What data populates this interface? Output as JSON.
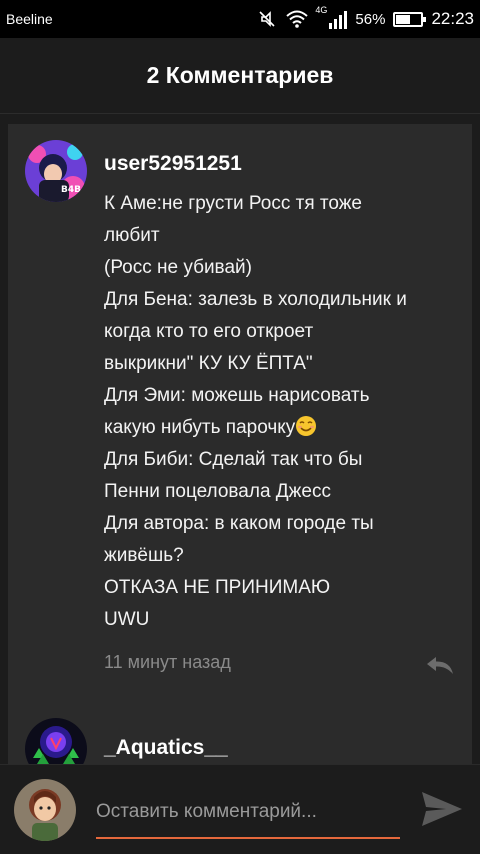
{
  "status_bar": {
    "carrier": "Beeline",
    "network": "4G",
    "battery": "56%",
    "battery_level": 0.56,
    "time": "22:23"
  },
  "header": {
    "title": "2 Комментариев"
  },
  "comments": [
    {
      "username": "user52951251",
      "avatar_text": "B4B",
      "lines": [
        "К Аме:не грусти Росс тя тоже",
        "любит",
        "(Росс не убивай)",
        "Для Бена: залезь в холодильник и",
        "когда кто то его откроет",
        "выкрикни\" КУ КУ ЁПТА\"",
        "Для Эми: можешь нарисовать",
        "какую нибуть парочку",
        "Для Биби: Сделай так что бы",
        "Пенни поцеловала Джесс",
        "Для автора: в каком городе ты",
        "живёшь?",
        "ОТКАЗА НЕ ПРИНИМАЮ",
        "UWU"
      ],
      "time_ago": "11 минут назад"
    },
    {
      "username": "_Aquatics__"
    }
  ],
  "input": {
    "placeholder": "Оставить комментарий..."
  },
  "colors": {
    "accent": "#e5683c",
    "card": "#2b2b2b",
    "background": "#1c1c1c"
  },
  "icons": [
    "mute-icon",
    "wifi-icon",
    "signal-icon",
    "battery-icon",
    "reply-icon",
    "send-icon",
    "smiling-face-emoji"
  ]
}
